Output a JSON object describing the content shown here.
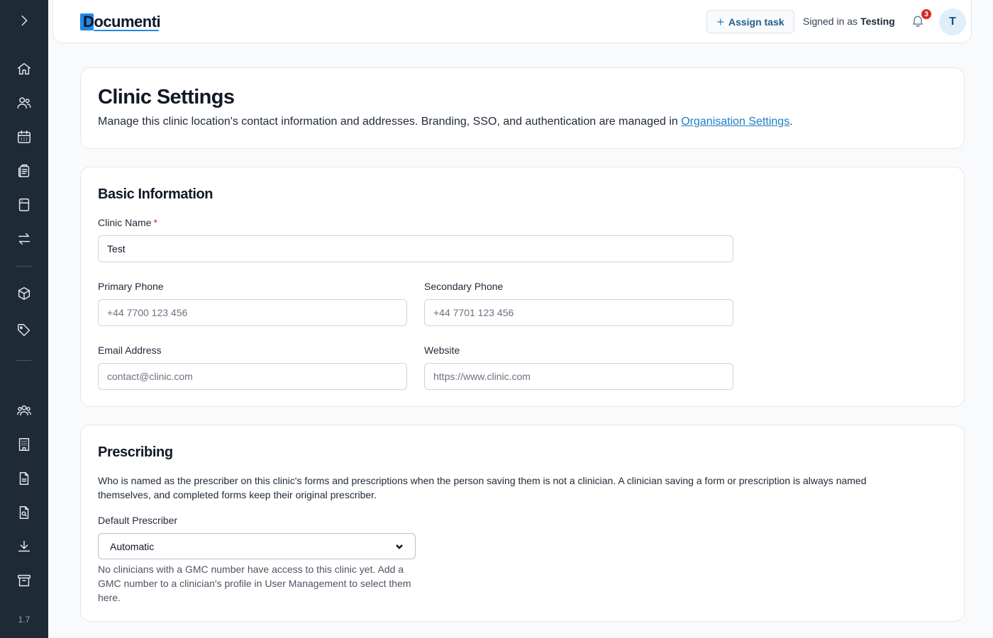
{
  "sidebar": {
    "version": "1.7",
    "icons": [
      "chevron-right-icon",
      "home-icon",
      "users-icon",
      "calendar-icon",
      "clipboard-icon",
      "archive-box-icon",
      "arrows-exchange-icon",
      "cube-icon",
      "tag-icon",
      "user-group-icon",
      "building-icon",
      "document-icon",
      "document-search-icon",
      "download-icon",
      "archive-icon"
    ]
  },
  "header": {
    "logo_text": "Documenti",
    "assign_task_label": "Assign task",
    "signed_in_prefix": "Signed in as",
    "signed_in_user": "Testing",
    "notification_count": "3",
    "avatar_initial": "T"
  },
  "page": {
    "title": "Clinic Settings",
    "description": "Manage this clinic location's contact information and addresses. Branding, SSO, and authentication are managed in",
    "description_link": "Organisation Settings",
    "description_end": "."
  },
  "basic_info": {
    "title": "Basic Information",
    "clinic_name_label": "Clinic Name",
    "required_marker": "*",
    "clinic_name_value": "Test",
    "primary_phone_label": "Primary Phone",
    "primary_phone_placeholder": "+44 7700 123 456",
    "secondary_phone_label": "Secondary Phone",
    "secondary_phone_placeholder": "+44 7701 123 456",
    "email_label": "Email Address",
    "email_placeholder": "contact@clinic.com",
    "website_label": "Website",
    "website_placeholder": "https://www.clinic.com"
  },
  "prescribing": {
    "title": "Prescribing",
    "description": "Who is named as the prescriber on this clinic's forms and prescriptions when the person saving them is not a clinician. A clinician saving a form or prescription is always named themselves, and completed forms keep their original prescriber.",
    "default_prescriber_label": "Default Prescriber",
    "default_prescriber_value": "Automatic",
    "help_text": "No clinicians with a GMC number have access to this clinic yet. Add a GMC number to a clinician's profile in User Management to select them here."
  }
}
